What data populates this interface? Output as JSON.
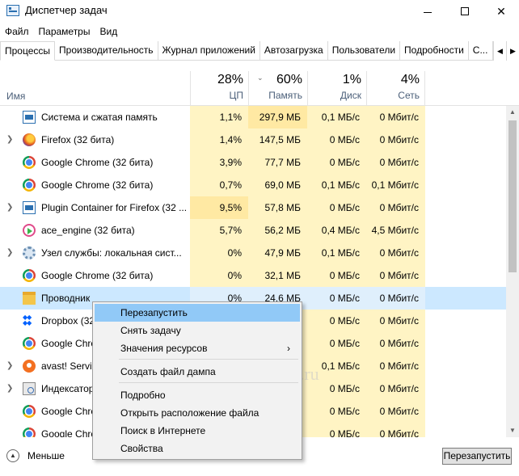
{
  "window": {
    "title": "Диспетчер задач"
  },
  "menu": [
    "Файл",
    "Параметры",
    "Вид"
  ],
  "tabs": [
    "Процессы",
    "Производительность",
    "Журнал приложений",
    "Автозагрузка",
    "Пользователи",
    "Подробности",
    "С..."
  ],
  "columns": {
    "name": "Имя",
    "cpu": {
      "pct": "28%",
      "label": "ЦП"
    },
    "mem": {
      "pct": "60%",
      "label": "Память"
    },
    "disk": {
      "pct": "1%",
      "label": "Диск"
    },
    "net": {
      "pct": "4%",
      "label": "Сеть"
    }
  },
  "rows": [
    {
      "name": "Система и сжатая память",
      "icon": "system-icon",
      "cpu": "1,1%",
      "mem": "297,9 МБ",
      "disk": "0,1 МБ/с",
      "net": "0 Мбит/с"
    },
    {
      "name": "Firefox (32 бита)",
      "icon": "firefox-icon",
      "cpu": "1,4%",
      "mem": "147,5 МБ",
      "disk": "0 МБ/с",
      "net": "0 Мбит/с"
    },
    {
      "name": "Google Chrome (32 бита)",
      "icon": "chrome-icon",
      "cpu": "3,9%",
      "mem": "77,7 МБ",
      "disk": "0 МБ/с",
      "net": "0 Мбит/с"
    },
    {
      "name": "Google Chrome (32 бита)",
      "icon": "chrome-icon",
      "cpu": "0,7%",
      "mem": "69,0 МБ",
      "disk": "0,1 МБ/с",
      "net": "0,1 Мбит/с"
    },
    {
      "name": "Plugin Container for Firefox (32 ...",
      "icon": "system-icon",
      "cpu": "9,5%",
      "mem": "57,8 МБ",
      "disk": "0 МБ/с",
      "net": "0 Мбит/с"
    },
    {
      "name": "ace_engine (32 бита)",
      "icon": "ace-engine-icon",
      "cpu": "5,7%",
      "mem": "56,2 МБ",
      "disk": "0,4 МБ/с",
      "net": "4,5 Мбит/с"
    },
    {
      "name": "Узел службы: локальная сист...",
      "icon": "gear-icon",
      "cpu": "0%",
      "mem": "47,9 МБ",
      "disk": "0,1 МБ/с",
      "net": "0 Мбит/с"
    },
    {
      "name": "Google Chrome (32 бита)",
      "icon": "chrome-icon",
      "cpu": "0%",
      "mem": "32,1 МБ",
      "disk": "0 МБ/с",
      "net": "0 Мбит/с"
    },
    {
      "name": "Проводник",
      "icon": "folder-icon",
      "cpu": "0%",
      "mem": "24,6 МБ",
      "disk": "0 МБ/с",
      "net": "0 Мбит/с"
    },
    {
      "name": "Dropbox (32",
      "icon": "dropbox-icon",
      "cpu": "",
      "mem": "",
      "disk": "0 МБ/с",
      "net": "0 Мбит/с"
    },
    {
      "name": "Google Chro",
      "icon": "chrome-icon",
      "cpu": "",
      "mem": "",
      "disk": "0 МБ/с",
      "net": "0 Мбит/с"
    },
    {
      "name": "avast! Servic",
      "icon": "avast-icon",
      "cpu": "",
      "mem": "",
      "disk": "0,1 МБ/с",
      "net": "0 Мбит/с"
    },
    {
      "name": "Индексатор",
      "icon": "indexer-icon",
      "cpu": "",
      "mem": "",
      "disk": "0 МБ/с",
      "net": "0 Мбит/с"
    },
    {
      "name": "Google Chro",
      "icon": "chrome-icon",
      "cpu": "",
      "mem": "",
      "disk": "0 МБ/с",
      "net": "0 Мбит/с"
    },
    {
      "name": "Google Chro",
      "icon": "chrome-icon",
      "cpu": "",
      "mem": "",
      "disk": "0 МБ/с",
      "net": "0 Мбит/с"
    }
  ],
  "context_menu": [
    "Перезапустить",
    "Снять задачу",
    "Значения ресурсов",
    "Создать файл дампа",
    "Подробно",
    "Открыть расположение файла",
    "Поиск в Интернете",
    "Свойства"
  ],
  "footer": {
    "less_label": "Меньше",
    "restart_label": "Перезапустить"
  },
  "watermark": "cho-cho.ru"
}
